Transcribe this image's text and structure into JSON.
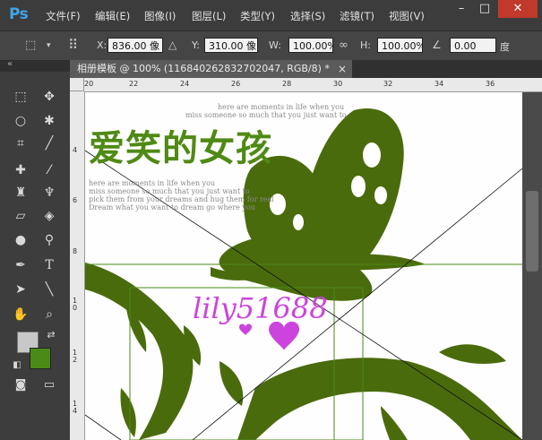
{
  "app": {
    "logo": "Ps"
  },
  "menu": [
    "文件(F)",
    "编辑(E)",
    "图像(I)",
    "图层(L)",
    "类型(Y)",
    "选择(S)",
    "滤镜(T)",
    "视图(V)"
  ],
  "window_controls": {
    "minimize": "–",
    "restore": "□",
    "close": "✕"
  },
  "options": {
    "x_label": "X:",
    "x_value": "836.00 像",
    "y_label": "Y:",
    "y_value": "310.00 像",
    "w_label": "W:",
    "w_value": "100.00%",
    "h_label": "H:",
    "h_value": "100.00%",
    "angle_value": "0.00",
    "angle_unit": "度"
  },
  "document": {
    "tab_title": "相册模板 @ 100% (116840262832702047, RGB/8) *",
    "close": "×"
  },
  "ruler": {
    "h_ticks": [
      "20",
      "22",
      "24",
      "26",
      "28",
      "30",
      "32",
      "34",
      "36"
    ],
    "v_ticks": [
      "4",
      "6",
      "8",
      "1\n0",
      "1\n2",
      "1\n4"
    ]
  },
  "canvas": {
    "title": "爱笑的女孩",
    "watermark": "lily51688",
    "small_lines_top": [
      "here are moments in life when you",
      "miss someone so much that you just want to"
    ],
    "small_lines_left": [
      "here are moments in life when you",
      "miss someone so much that you just want to",
      "pick them from your dreams and hug them for real",
      "Dream what you want to dream go where you"
    ]
  },
  "colors": {
    "foreground": "#c8c8c8",
    "background": "#4a8a16",
    "art_green": "#4a6b0c",
    "watermark": "#cc44dd"
  },
  "tools": [
    "marquee-icon",
    "move-icon",
    "lasso-icon",
    "magic-wand-icon",
    "crop-icon",
    "eyedropper-icon",
    "healing-icon",
    "brush-icon",
    "stamp-icon",
    "history-brush-icon",
    "eraser-icon",
    "paint-bucket-icon",
    "blur-icon",
    "dodge-icon",
    "pen-icon",
    "type-icon",
    "path-select-icon",
    "line-icon",
    "hand-icon",
    "zoom-icon"
  ]
}
